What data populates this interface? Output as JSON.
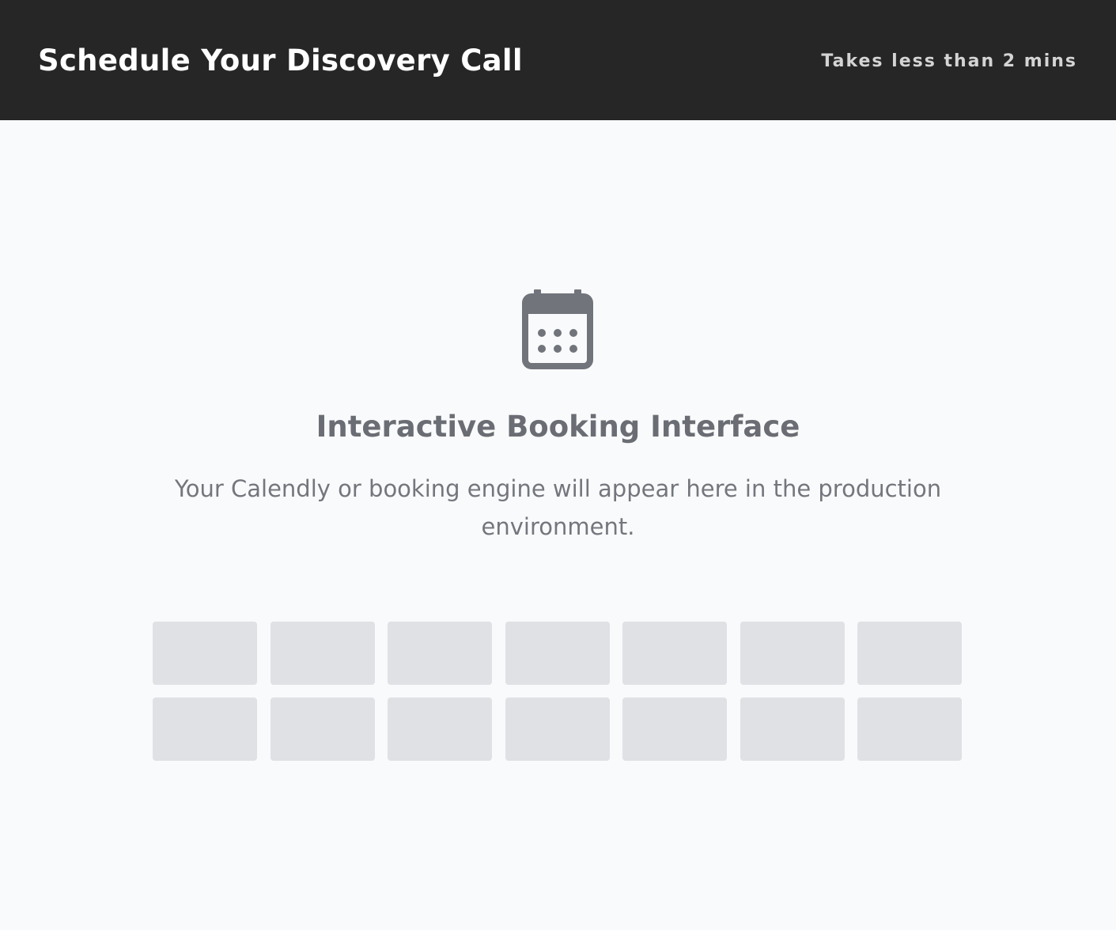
{
  "header": {
    "title": "Schedule Your Discovery Call",
    "note": "Takes less than 2 mins",
    "background_color": "#262626"
  },
  "main": {
    "icon": "calendar-icon",
    "heading": "Interactive Booking Interface",
    "description": "Your Calendly or booking engine will appear here in the production environment.",
    "placeholder_color": "#e0e1e5",
    "slots": [
      {
        "row": 1,
        "col": 1
      },
      {
        "row": 1,
        "col": 2
      },
      {
        "row": 1,
        "col": 3
      },
      {
        "row": 1,
        "col": 4
      },
      {
        "row": 1,
        "col": 5
      },
      {
        "row": 1,
        "col": 6
      },
      {
        "row": 1,
        "col": 7
      },
      {
        "row": 2,
        "col": 1
      },
      {
        "row": 2,
        "col": 2
      },
      {
        "row": 2,
        "col": 3
      },
      {
        "row": 2,
        "col": 4
      },
      {
        "row": 2,
        "col": 5
      },
      {
        "row": 2,
        "col": 6
      },
      {
        "row": 2,
        "col": 7
      }
    ]
  }
}
